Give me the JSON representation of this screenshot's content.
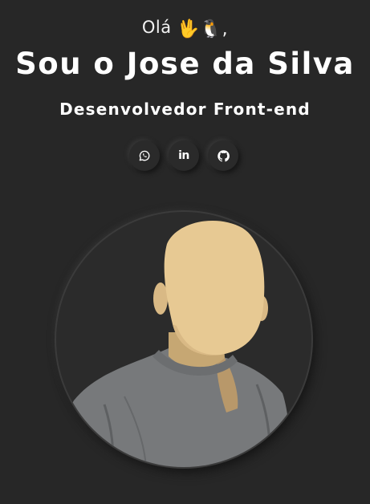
{
  "hero": {
    "greeting": "Olá",
    "greeting_emoji": "🖖🐧,",
    "title": "Sou o Jose da Silva",
    "subtitle": "Desenvolvedor Front-end"
  },
  "socials": [
    {
      "name": "whatsapp",
      "icon": "whatsapp-icon"
    },
    {
      "name": "linkedin",
      "icon": "linkedin-icon",
      "glyph": "in"
    },
    {
      "name": "github",
      "icon": "github-icon"
    }
  ],
  "avatar": {
    "icon": "avatar-illustration",
    "skin_color": "#e7c993",
    "shirt_color": "#77797b"
  },
  "colors": {
    "background": "#272727",
    "text": "#ffffff"
  }
}
